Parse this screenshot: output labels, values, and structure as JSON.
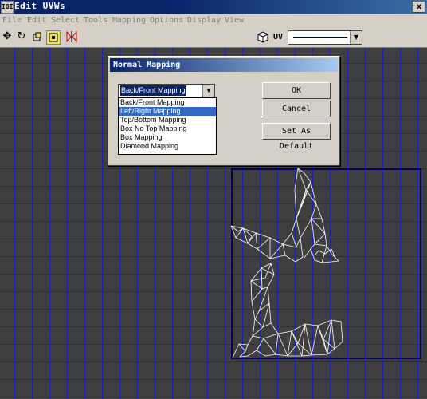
{
  "window": {
    "title": "Edit UVWs",
    "app_icon": "IOI",
    "close_glyph": "x"
  },
  "menu": [
    "File",
    "Edit",
    "Select",
    "Tools",
    "Mapping",
    "Options",
    "Display",
    "View"
  ],
  "toolbar": {
    "uv_label": "UV",
    "icons": [
      "move-icon",
      "rotate-icon",
      "scale-icon",
      "freeform-icon",
      "mirror-icon",
      "cube-icon"
    ]
  },
  "dialog": {
    "title": "Normal Mapping",
    "selected": "Back/Front Mapping",
    "options": [
      "Back/Front Mapping",
      "Left/Right Mapping",
      "Top/Bottom Mapping",
      "Box No Top Mapping",
      "Box Mapping",
      "Diamond Mapping"
    ],
    "highlighted_index": 1,
    "buttons": {
      "ok": "OK",
      "cancel": "Cancel",
      "default": "Set As Default"
    }
  },
  "colors": {
    "grid": "#2020b0",
    "viewport_bg": "#3f3f3f",
    "mesh": "#ffffff",
    "boundary": "#000060"
  }
}
